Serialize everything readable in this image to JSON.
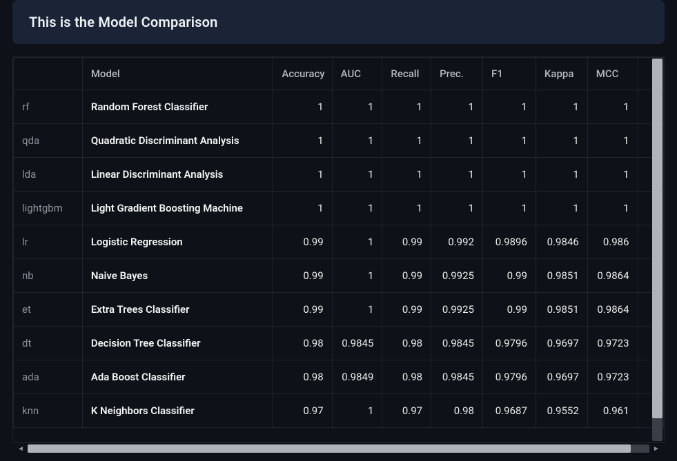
{
  "title": "This is the Model Comparison",
  "columns": {
    "index": "",
    "model": "Model",
    "accuracy": "Accuracy",
    "auc": "AUC",
    "recall": "Recall",
    "prec": "Prec.",
    "f1": "F1",
    "kappa": "Kappa",
    "mcc": "MCC"
  },
  "rows": [
    {
      "id": "rf",
      "model": "Random Forest Classifier",
      "accuracy": "1",
      "auc": "1",
      "recall": "1",
      "prec": "1",
      "f1": "1",
      "kappa": "1",
      "mcc": "1"
    },
    {
      "id": "qda",
      "model": "Quadratic Discriminant Analysis",
      "accuracy": "1",
      "auc": "1",
      "recall": "1",
      "prec": "1",
      "f1": "1",
      "kappa": "1",
      "mcc": "1"
    },
    {
      "id": "lda",
      "model": "Linear Discriminant Analysis",
      "accuracy": "1",
      "auc": "1",
      "recall": "1",
      "prec": "1",
      "f1": "1",
      "kappa": "1",
      "mcc": "1"
    },
    {
      "id": "lightgbm",
      "model": "Light Gradient Boosting Machine",
      "accuracy": "1",
      "auc": "1",
      "recall": "1",
      "prec": "1",
      "f1": "1",
      "kappa": "1",
      "mcc": "1"
    },
    {
      "id": "lr",
      "model": "Logistic Regression",
      "accuracy": "0.99",
      "auc": "1",
      "recall": "0.99",
      "prec": "0.992",
      "f1": "0.9896",
      "kappa": "0.9846",
      "mcc": "0.986"
    },
    {
      "id": "nb",
      "model": "Naive Bayes",
      "accuracy": "0.99",
      "auc": "1",
      "recall": "0.99",
      "prec": "0.9925",
      "f1": "0.99",
      "kappa": "0.9851",
      "mcc": "0.9864"
    },
    {
      "id": "et",
      "model": "Extra Trees Classifier",
      "accuracy": "0.99",
      "auc": "1",
      "recall": "0.99",
      "prec": "0.9925",
      "f1": "0.99",
      "kappa": "0.9851",
      "mcc": "0.9864"
    },
    {
      "id": "dt",
      "model": "Decision Tree Classifier",
      "accuracy": "0.98",
      "auc": "0.9845",
      "recall": "0.98",
      "prec": "0.9845",
      "f1": "0.9796",
      "kappa": "0.9697",
      "mcc": "0.9723"
    },
    {
      "id": "ada",
      "model": "Ada Boost Classifier",
      "accuracy": "0.98",
      "auc": "0.9849",
      "recall": "0.98",
      "prec": "0.9845",
      "f1": "0.9796",
      "kappa": "0.9697",
      "mcc": "0.9723"
    },
    {
      "id": "knn",
      "model": "K Neighbors Classifier",
      "accuracy": "0.97",
      "auc": "1",
      "recall": "0.97",
      "prec": "0.98",
      "f1": "0.9687",
      "kappa": "0.9552",
      "mcc": "0.961"
    }
  ],
  "chart_data": {
    "type": "table",
    "title": "This is the Model Comparison",
    "columns": [
      "id",
      "Model",
      "Accuracy",
      "AUC",
      "Recall",
      "Prec.",
      "F1",
      "Kappa",
      "MCC"
    ],
    "rows": [
      [
        "rf",
        "Random Forest Classifier",
        1,
        1,
        1,
        1,
        1,
        1,
        1
      ],
      [
        "qda",
        "Quadratic Discriminant Analysis",
        1,
        1,
        1,
        1,
        1,
        1,
        1
      ],
      [
        "lda",
        "Linear Discriminant Analysis",
        1,
        1,
        1,
        1,
        1,
        1,
        1
      ],
      [
        "lightgbm",
        "Light Gradient Boosting Machine",
        1,
        1,
        1,
        1,
        1,
        1,
        1
      ],
      [
        "lr",
        "Logistic Regression",
        0.99,
        1,
        0.99,
        0.992,
        0.9896,
        0.9846,
        0.986
      ],
      [
        "nb",
        "Naive Bayes",
        0.99,
        1,
        0.99,
        0.9925,
        0.99,
        0.9851,
        0.9864
      ],
      [
        "et",
        "Extra Trees Classifier",
        0.99,
        1,
        0.99,
        0.9925,
        0.99,
        0.9851,
        0.9864
      ],
      [
        "dt",
        "Decision Tree Classifier",
        0.98,
        0.9845,
        0.98,
        0.9845,
        0.9796,
        0.9697,
        0.9723
      ],
      [
        "ada",
        "Ada Boost Classifier",
        0.98,
        0.9849,
        0.98,
        0.9845,
        0.9796,
        0.9697,
        0.9723
      ],
      [
        "knn",
        "K Neighbors Classifier",
        0.97,
        1,
        0.97,
        0.98,
        0.9687,
        0.9552,
        0.961
      ]
    ]
  }
}
